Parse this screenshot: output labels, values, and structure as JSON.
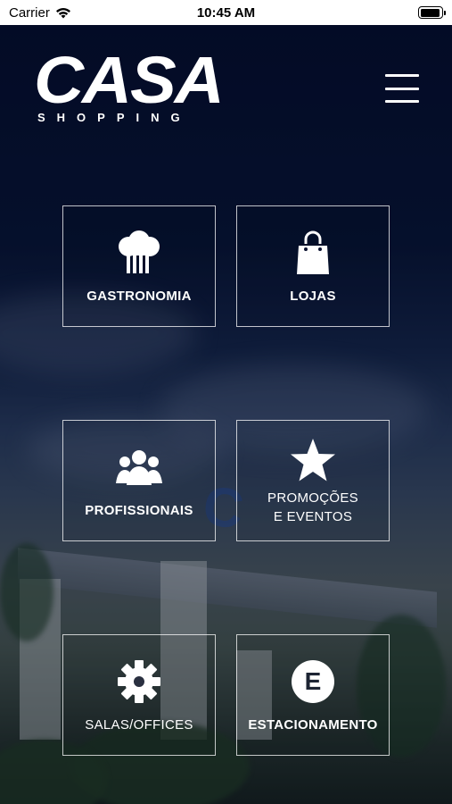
{
  "status_bar": {
    "carrier": "Carrier",
    "time": "10:45 AM",
    "battery_level": 0.95
  },
  "logo": {
    "main": "CASA",
    "sub": "SHOPPING"
  },
  "tiles": [
    {
      "label": "GASTRONOMIA",
      "icon": "chef-hat-icon"
    },
    {
      "label": "LOJAS",
      "icon": "shopping-bag-icon"
    },
    {
      "label": "PROFISSIONAIS",
      "icon": "people-group-icon"
    },
    {
      "label": "PROMOÇÕES\nE EVENTOS",
      "icon": "star-icon"
    },
    {
      "label": "SALAS/OFFICES",
      "icon": "gear-icon"
    },
    {
      "label": "ESTACIONAMENTO",
      "icon": "parking-e-icon"
    }
  ],
  "colors": {
    "background": "#0b1230",
    "tile_border": "#ffffff",
    "text": "#ffffff"
  }
}
